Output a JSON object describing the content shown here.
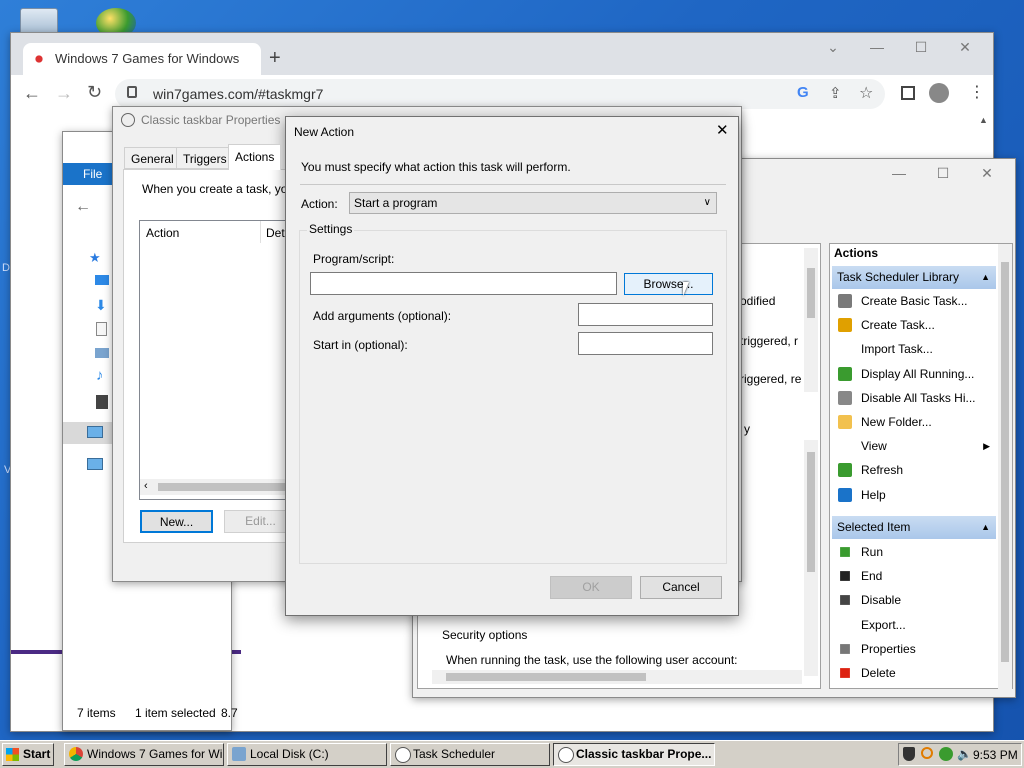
{
  "browser": {
    "tab_title": "Windows 7 Games for Windows",
    "url": "win7games.com/#taskmgr7"
  },
  "explorer": {
    "file_tab": "File",
    "status_items": "7 items",
    "status_selected": "1 item selected",
    "status_size": "8.7"
  },
  "scheduler": {
    "actions_header": "Actions",
    "library_section": "Task Scheduler Library",
    "library_items": [
      "Create Basic Task...",
      "Create Task...",
      "Import Task...",
      "Display All Running...",
      "Disable All Tasks Hi...",
      "New Folder...",
      "View",
      "Refresh",
      "Help"
    ],
    "selected_section": "Selected Item",
    "selected_items": [
      "Run",
      "End",
      "Disable",
      "Export...",
      "Properties",
      "Delete"
    ],
    "list_col_text": [
      "odified",
      "triggered, r",
      "riggered, re"
    ],
    "section_label": "y",
    "security_label": "Security options",
    "security_text": "When running the task, use the following user account:"
  },
  "props": {
    "title": "Classic taskbar Properties (Local Computer)",
    "tabs": [
      "General",
      "Triggers",
      "Actions"
    ],
    "intro": "When you create a task, you",
    "col_action": "Action",
    "col_details": "Deta",
    "new_btn": "New...",
    "edit_btn": "Edit..."
  },
  "dialog": {
    "title": "New Action",
    "prompt": "You must specify what action this task will perform.",
    "action_label": "Action:",
    "action_value": "Start a program",
    "settings_label": "Settings",
    "program_label": "Program/script:",
    "program_value": "",
    "browse_btn": "Browse...",
    "args_label": "Add arguments (optional):",
    "args_value": "",
    "startin_label": "Start in (optional):",
    "startin_value": "",
    "ok_btn": "OK",
    "cancel_btn": "Cancel"
  },
  "taskbar": {
    "start": "Start",
    "buttons": [
      "Windows 7 Games for Win...",
      "Local Disk (C:)",
      "Task Scheduler",
      "Classic taskbar Prope..."
    ],
    "clock": "9:53 PM"
  }
}
